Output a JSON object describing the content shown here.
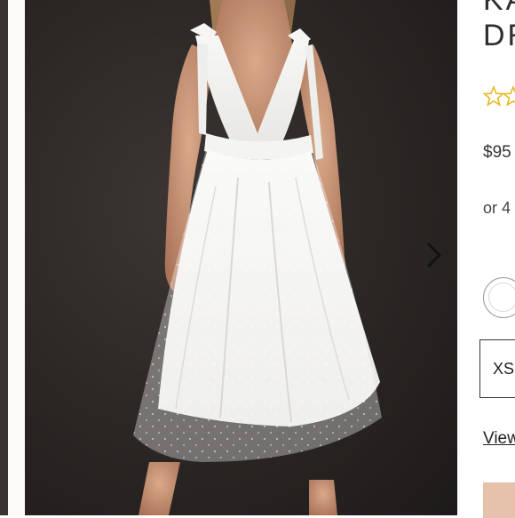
{
  "product": {
    "title_line1": "KA",
    "title_line2": "DR",
    "price": "$95",
    "installment_text": "or 4",
    "size_option": "XS",
    "view_link": "View",
    "rating_icon": "star-outline-icon",
    "accent_color": "#e8b923",
    "cta_color": "#e6c2ad"
  },
  "gallery": {
    "next_icon": "chevron-right-icon"
  }
}
